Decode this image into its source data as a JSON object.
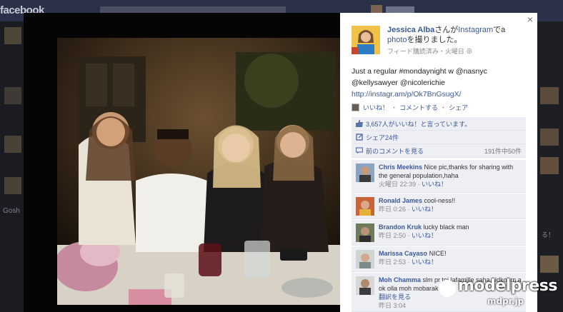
{
  "background": {
    "site_logo": "facebook",
    "left_text_1": "Gosh",
    "right_text_1": "る！"
  },
  "photo": {
    "alt": "Instagram photo"
  },
  "panel": {
    "close_label": "×",
    "author_name": "Jessica Alba",
    "author_mid": "さんが",
    "app_name": "Instagram",
    "author_mid2": "で",
    "photo_link": "photo",
    "author_tail": "を撮りました。",
    "meta": "フィード購読済み・火曜日",
    "post_line_1": "Just a regular #mondaynight w @nasnyc",
    "post_line_2": "@kellysawyer @nicolerichie",
    "post_url": "http://instagr.am/p/Ok7BnGsugX/",
    "action_like": "いいね！",
    "action_comment": "コメントする",
    "action_share": "シェア",
    "likes_text": "3,657人がいいね！と言っています。",
    "shares_text": "シェア24件",
    "prev_comments": "前のコメントを見る",
    "comment_count": "191件中50件"
  },
  "comments": [
    {
      "name": "Chris Meekins",
      "text": "Nice pic,thanks for sharing with the general population,haha",
      "time": "火曜日 22:39",
      "like": "いいね！"
    },
    {
      "name": "Ronald James",
      "text": "cool-ness!!",
      "time": "昨日 0:26",
      "like": "いいね！"
    },
    {
      "name": "Brandon Kruk",
      "text": "lucky black man",
      "time": "昨日 2:50",
      "like": "いいね！"
    },
    {
      "name": "Marissa Cayaso",
      "text": "NICE!",
      "time": "昨日 2:53",
      "like": "いいね！"
    },
    {
      "name": "Moh Chamma",
      "text": "slm pr toi lafamille saha aidkoum a ok olla moh mobarak",
      "time": "昨日 3:04",
      "like": "翻訳を見る"
    }
  ],
  "watermark": {
    "text": "modelpress",
    "sub": "mdpr.jp"
  },
  "colors": {
    "link": "#3b5998",
    "ufi_bg": "#edeff4",
    "topbar": "#2b3148"
  }
}
